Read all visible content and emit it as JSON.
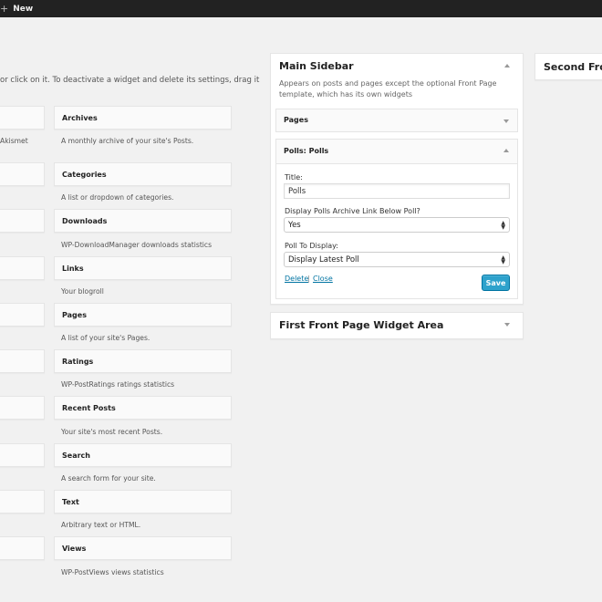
{
  "adminbar": {
    "plus": "+",
    "new_label": "New"
  },
  "intro_text": "or click on it. To deactivate a widget and delete its settings, drag it",
  "right_akismet_partial": "Akismet",
  "available_widgets": [
    {
      "name": "Archives",
      "desc": "A monthly archive of your site's Posts."
    },
    {
      "name": "Categories",
      "desc": "A list or dropdown of categories."
    },
    {
      "name": "Downloads",
      "desc": "WP-DownloadManager downloads statistics"
    },
    {
      "name": "Links",
      "desc": "Your blogroll"
    },
    {
      "name": "Pages",
      "desc": "A list of your site's Pages."
    },
    {
      "name": "Ratings",
      "desc": "WP-PostRatings ratings statistics"
    },
    {
      "name": "Recent Posts",
      "desc": "Your site's most recent Posts."
    },
    {
      "name": "Search",
      "desc": "A search form for your site."
    },
    {
      "name": "Text",
      "desc": "Arbitrary text or HTML."
    },
    {
      "name": "Views",
      "desc": "WP-PostViews views statistics"
    }
  ],
  "main_sidebar": {
    "title": "Main Sidebar",
    "desc": "Appears on posts and pages except the optional Front Page template, which has its own widgets",
    "widgets": {
      "pages": {
        "title": "Pages"
      },
      "polls": {
        "title": "Polls: Polls",
        "title_label": "Title:",
        "title_value": "Polls",
        "archive_label": "Display Polls Archive Link Below Poll?",
        "archive_value": "Yes",
        "poll_label": "Poll To Display:",
        "poll_value": "Display Latest Poll",
        "delete_label": "Delete",
        "separator": "|",
        "close_label": "Close",
        "save_label": "Save"
      }
    }
  },
  "first_front_area": {
    "title": "First Front Page Widget Area"
  },
  "second_front_area": {
    "title": "Second Front"
  },
  "colors": {
    "accent": "#2ea2cc",
    "link": "#0074a2",
    "adminbar": "#222222"
  }
}
